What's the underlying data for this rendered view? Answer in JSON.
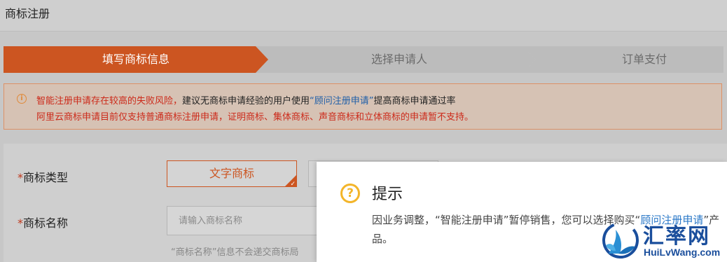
{
  "page": {
    "title": "商标注册"
  },
  "steps": [
    {
      "label": "填写商标信息",
      "active": true
    },
    {
      "label": "选择申请人",
      "active": false
    },
    {
      "label": "订单支付",
      "active": false
    }
  ],
  "alert": {
    "icon": "info-circle-icon",
    "line1_part1": "智能注册申请存在较高的失败风险，",
    "line1_part2": "建议无商标申请经验的用户使用",
    "line1_link": "“顾问注册申请”",
    "line1_part3": "提高商标申请通过率",
    "line2": "阿里云商标申请目前仅支持普通商标注册申请，证明商标、集体商标、声音商标和立体商标的申请暂不支持。"
  },
  "form": {
    "required_mark": "*",
    "type_label": "商标类型",
    "type_selected": "文字商标",
    "name_label": "商标名称",
    "name_placeholder": "请输入商标名称",
    "name_hint": "“商标名称”信息不会递交商标局"
  },
  "dialog": {
    "icon": "question-circle-icon",
    "title": "提示",
    "body_part1": "因业务调整，“智能注册申请”暂停销售，您可以选择购买“",
    "body_link": "顾问注册申请",
    "body_part2": "”产品。"
  },
  "watermark": {
    "text": "汇率网",
    "url_text": "HuiLvWang.com"
  },
  "colors": {
    "accent": "#cc5521",
    "alert_text": "#cc2a1a",
    "link": "#1f5fa8",
    "dialog_icon": "#f3b52a"
  }
}
